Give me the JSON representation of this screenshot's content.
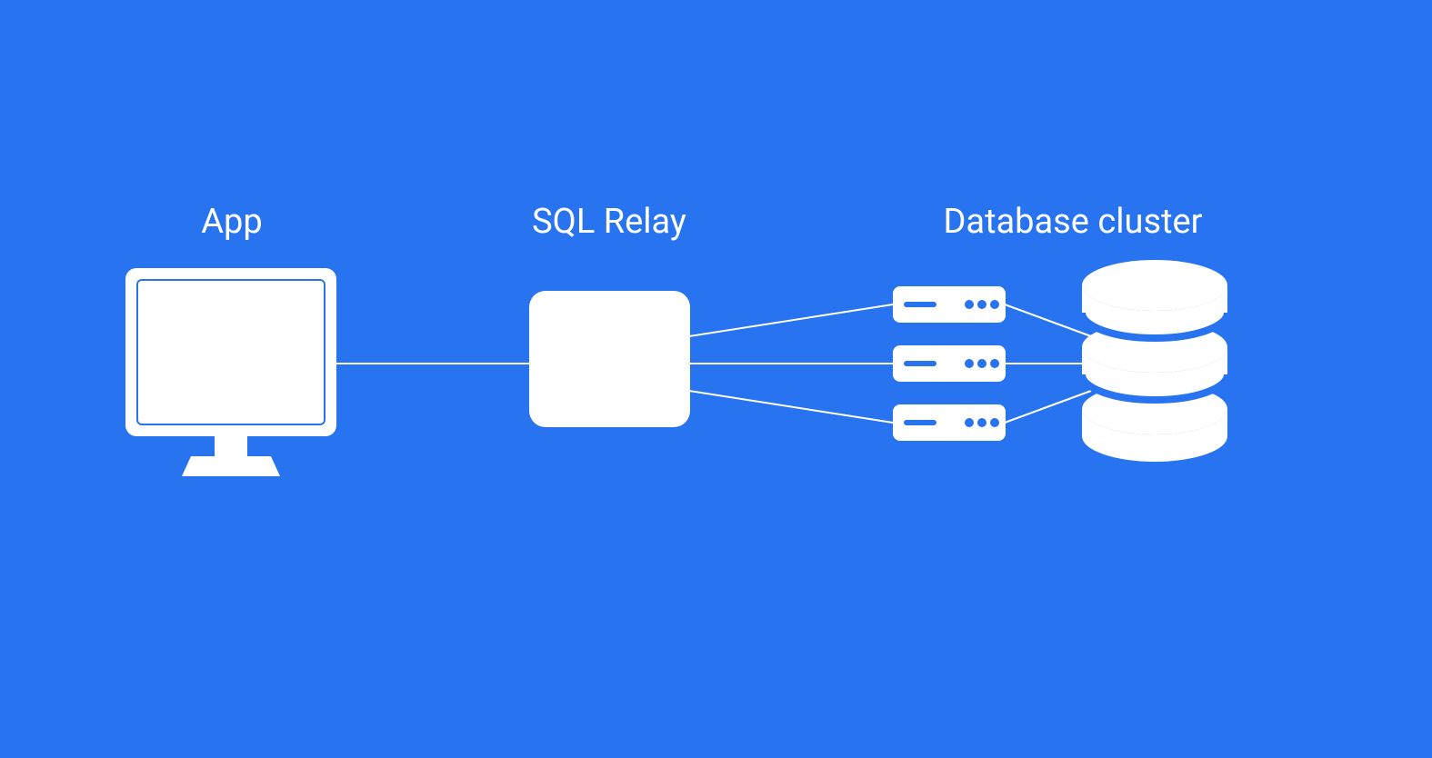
{
  "labels": {
    "app": "App",
    "relay": "SQL Relay",
    "cluster": "Database cluster"
  },
  "colors": {
    "background": "#2874F0",
    "foreground": "#ffffff"
  },
  "diagram": {
    "nodes": [
      {
        "id": "app",
        "type": "monitor"
      },
      {
        "id": "relay",
        "type": "box"
      },
      {
        "id": "server1",
        "type": "server"
      },
      {
        "id": "server2",
        "type": "server"
      },
      {
        "id": "server3",
        "type": "server"
      },
      {
        "id": "db",
        "type": "cylinder"
      }
    ],
    "connections": [
      {
        "from": "app",
        "to": "relay"
      },
      {
        "from": "relay",
        "to": "server1"
      },
      {
        "from": "relay",
        "to": "server2"
      },
      {
        "from": "relay",
        "to": "server3"
      },
      {
        "from": "server1",
        "to": "db"
      },
      {
        "from": "server2",
        "to": "db"
      },
      {
        "from": "server3",
        "to": "db"
      }
    ]
  }
}
